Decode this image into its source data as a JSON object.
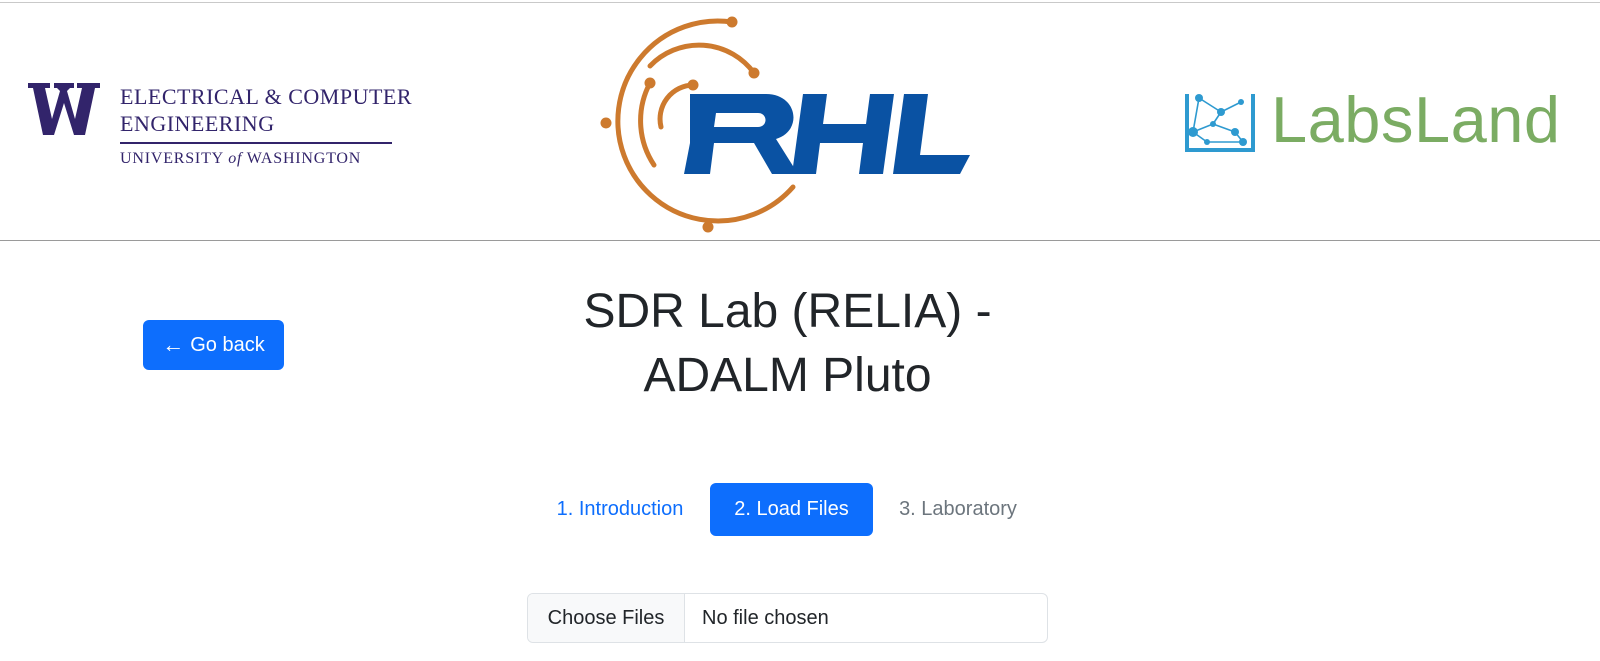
{
  "header": {
    "uw_logo": {
      "line1": "ELECTRICAL & COMPUTER",
      "line2": "ENGINEERING",
      "line3_pre": "UNIVERSITY ",
      "line3_of": "of",
      "line3_post": " WASHINGTON",
      "brand_color": "#32246b"
    },
    "rhl_logo": {
      "text": "RHL",
      "blue": "#0a52a3",
      "orange": "#cd7a2e"
    },
    "labsland_logo": {
      "text": "LabsLand",
      "text_color": "#7bac63",
      "icon_color": "#2e9ad0"
    }
  },
  "page": {
    "title_line1": "SDR Lab (RELIA) -",
    "title_line2": "ADALM Pluto"
  },
  "go_back": {
    "arrow_icon": "arrow-left-icon",
    "label": "Go back"
  },
  "tabs": [
    {
      "label": "1. Introduction",
      "state": "link"
    },
    {
      "label": "2. Load Files",
      "state": "active"
    },
    {
      "label": "3. Laboratory",
      "state": "inactive"
    }
  ],
  "file_input": {
    "button_label": "Choose Files",
    "status": "No file chosen"
  },
  "colors": {
    "primary": "#0d6efd",
    "muted": "#6c757d",
    "text": "#212529"
  }
}
